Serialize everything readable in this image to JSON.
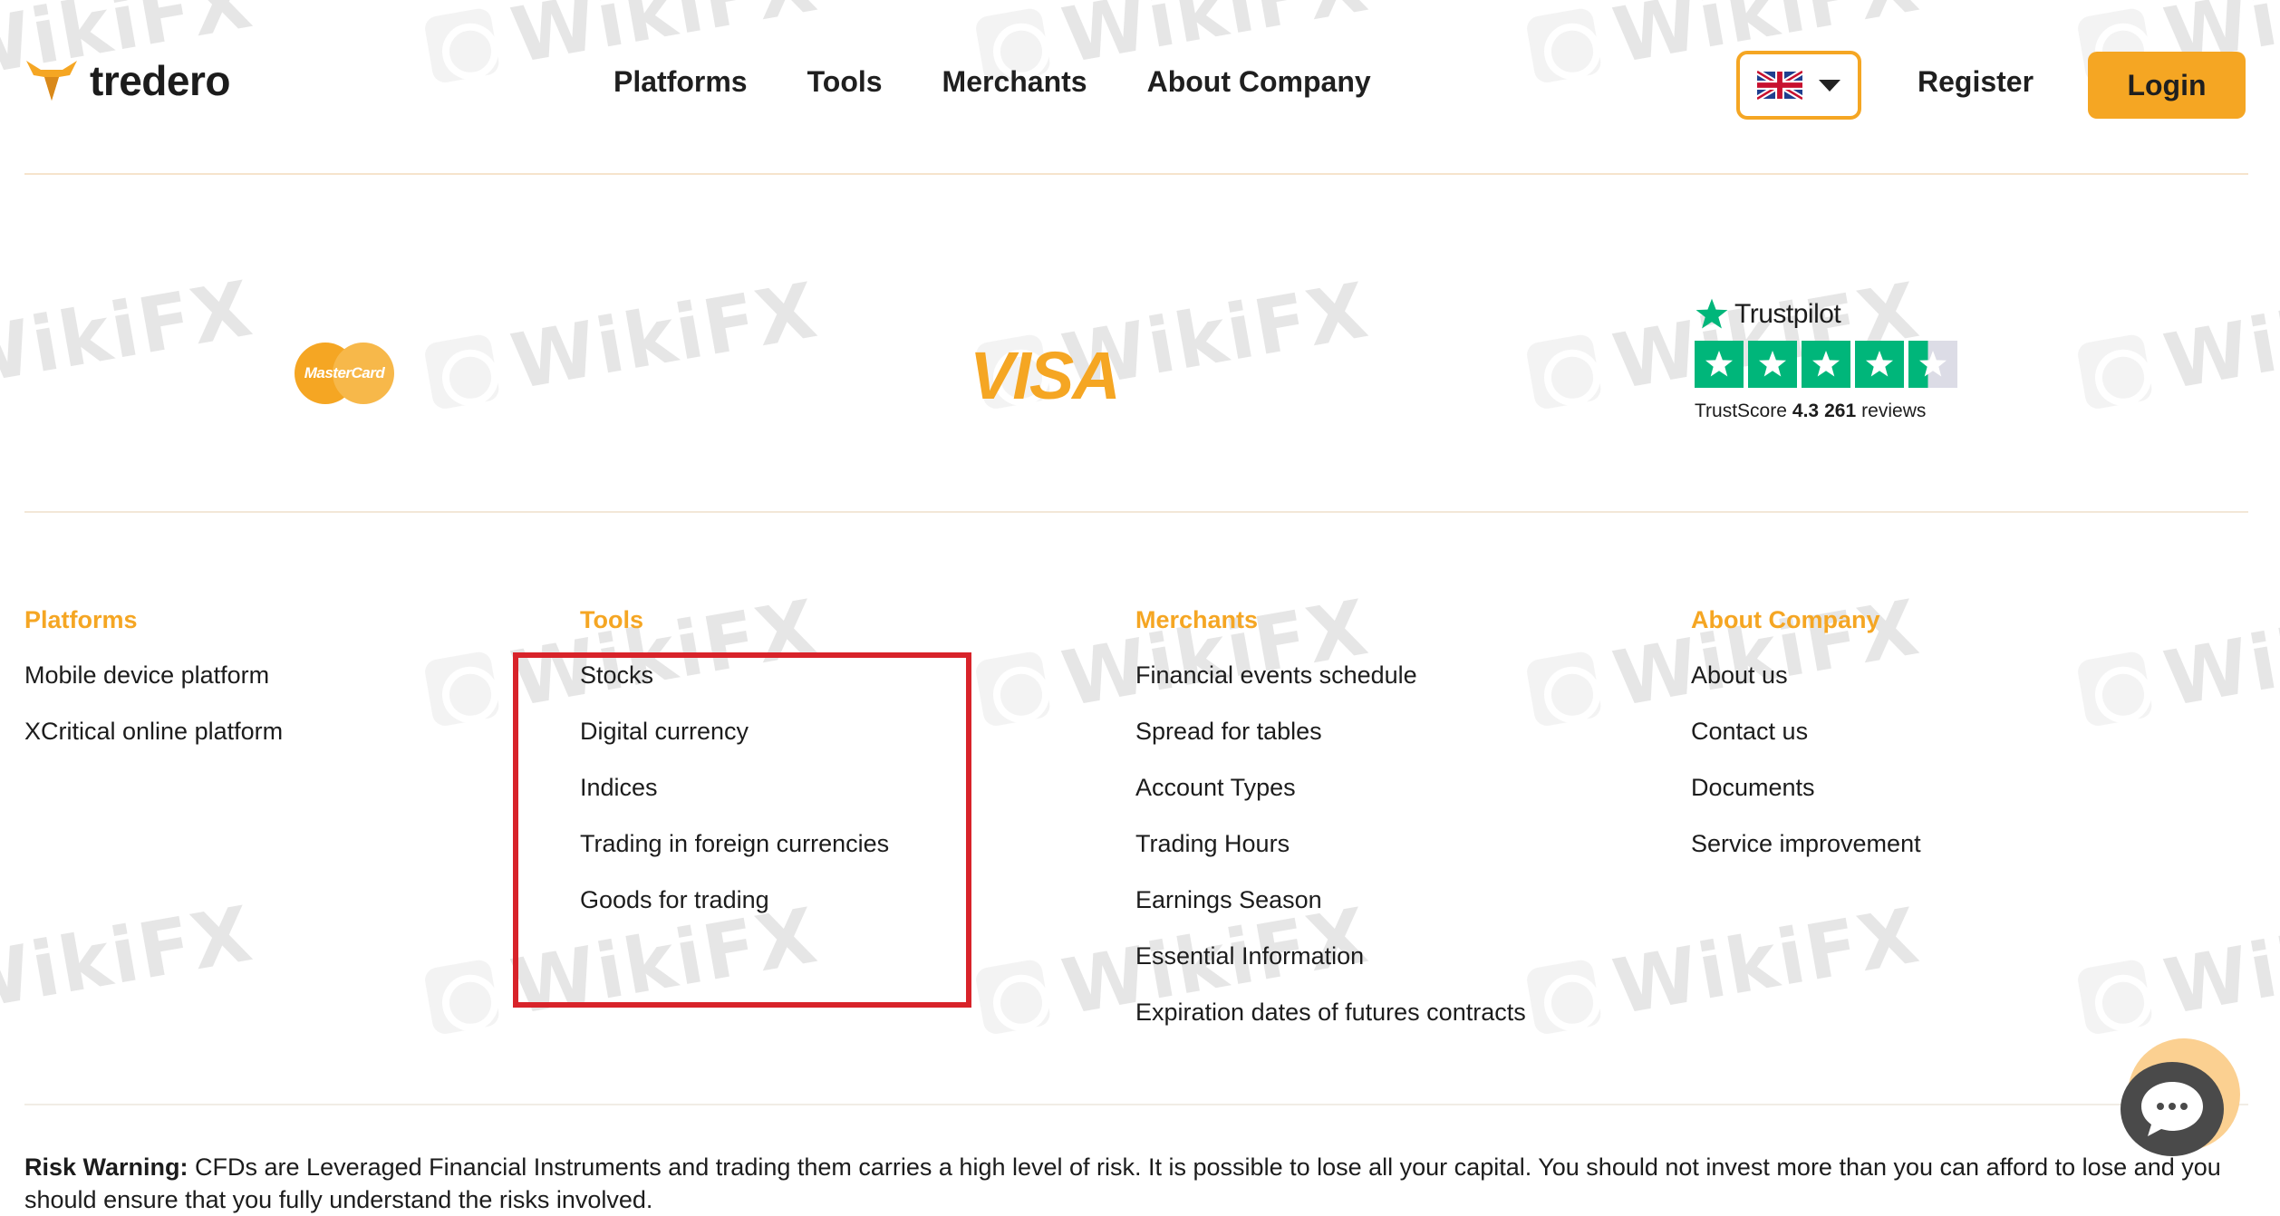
{
  "brand": {
    "name": "tredero",
    "accent": "#f5a623"
  },
  "nav": {
    "items": [
      "Platforms",
      "Tools",
      "Merchants",
      "About Company"
    ]
  },
  "header": {
    "language_flag": "uk-flag-icon",
    "register_label": "Register",
    "login_label": "Login"
  },
  "payments": {
    "mastercard_label": "MasterCard",
    "visa_label": "VISA"
  },
  "trustpilot": {
    "brand": "Trustpilot",
    "score_prefix": "TrustScore",
    "score": "4.3",
    "reviews_count": "261",
    "reviews_suffix": "reviews",
    "stars": 4.3,
    "star_color": "#00b67a"
  },
  "footer": {
    "columns": [
      {
        "title": "Platforms",
        "links": [
          "Mobile device platform",
          "XCritical online platform"
        ]
      },
      {
        "title": "Tools",
        "links": [
          "Stocks",
          "Digital currency",
          "Indices",
          "Trading in foreign currencies",
          "Goods for trading"
        ]
      },
      {
        "title": "Merchants",
        "links": [
          "Financial events schedule",
          "Spread for tables",
          "Account Types",
          "Trading Hours",
          "Earnings Season",
          "Essential Information",
          "Expiration dates of futures contracts"
        ]
      },
      {
        "title": "About Company",
        "links": [
          "About us",
          "Contact us",
          "Documents",
          "Service improvement"
        ]
      }
    ]
  },
  "risk_warning": {
    "label": "Risk Warning:",
    "text": "CFDs are Leveraged Financial Instruments and trading them carries a high level of risk. It is possible to lose all your capital. You should not invest more than you can afford to lose and you should ensure that you fully understand the risks involved."
  },
  "watermark": {
    "text": "WikiFX"
  },
  "annotation": {
    "highlight_color": "#d8232a"
  }
}
